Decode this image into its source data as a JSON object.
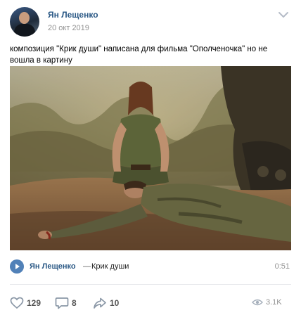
{
  "post": {
    "author": "Ян Лещенко",
    "date": "20 окт 2019",
    "text": "композиция \"Крик души\" написана для фильма \"Ополченочка\" но не вошла в картину"
  },
  "audio": {
    "artist": "Ян Лещенко",
    "separator": "—",
    "title": "Крик души",
    "duration": "0:51"
  },
  "actions": {
    "likes": "129",
    "comments": "8",
    "reposts": "10",
    "views": "3.1K"
  },
  "colors": {
    "link": "#2a5885",
    "accent": "#5181b8",
    "muted": "#939393"
  },
  "icons": {
    "menu": "chevron-down-icon",
    "play": "play-icon",
    "like": "heart-icon",
    "comment": "comment-icon",
    "repost": "share-icon",
    "views": "eye-icon"
  }
}
